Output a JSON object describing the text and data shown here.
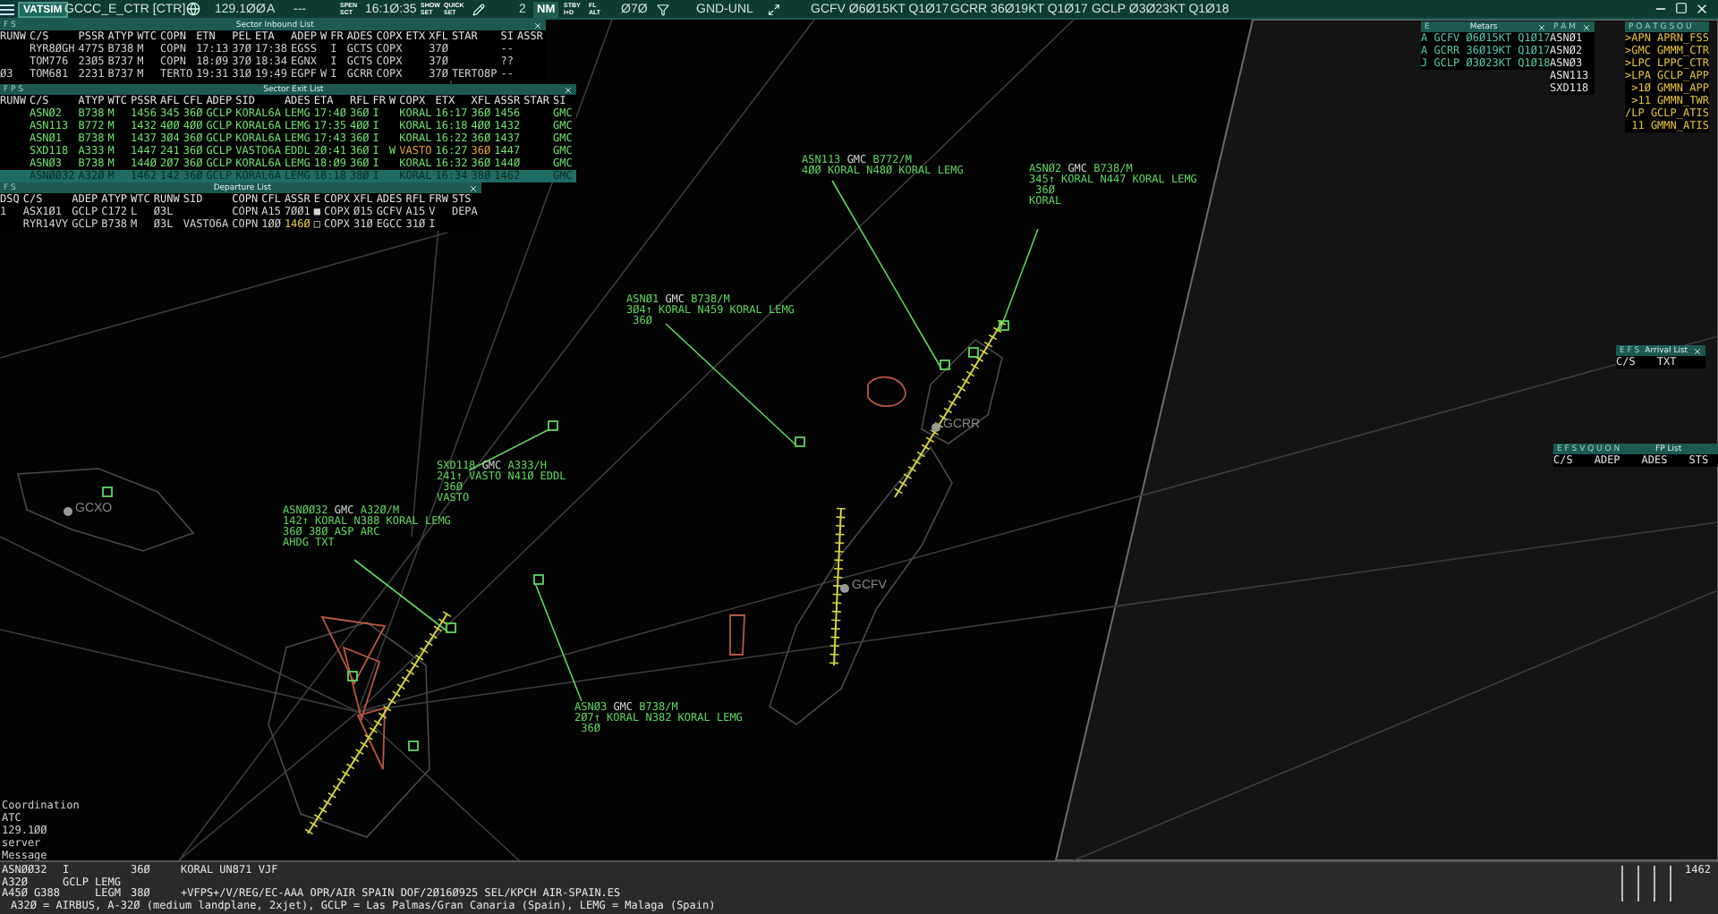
{
  "toolbar": {
    "items": [
      {
        "kind": "menu"
      },
      {
        "kind": "logo",
        "text": "VATSIM"
      },
      {
        "kind": "label",
        "text": "GCCC_E_CTR [CTR]"
      },
      {
        "kind": "globe"
      },
      {
        "kind": "label",
        "text": "129.1ØØ"
      },
      {
        "kind": "label",
        "text": "A"
      },
      {
        "kind": "label",
        "text": "---"
      },
      {
        "kind": "stack",
        "top": "SPEN",
        "bottom": "SCT"
      },
      {
        "kind": "label",
        "text": "16:1Ø:35"
      },
      {
        "kind": "stack",
        "top": "SHOW",
        "bottom": "SET"
      },
      {
        "kind": "stack",
        "top": "QUICK",
        "bottom": "SET"
      },
      {
        "kind": "pencil"
      },
      {
        "kind": "label",
        "text": "2"
      },
      {
        "kind": "button",
        "text": "NM"
      },
      {
        "kind": "stack",
        "top": "STBY",
        "bottom": "I+D"
      },
      {
        "kind": "stack",
        "top": "FL",
        "bottom": "ALT"
      },
      {
        "kind": "label",
        "text": "Ø7Ø"
      },
      {
        "kind": "filter"
      },
      {
        "kind": "label",
        "text": "GND-UNL"
      },
      {
        "kind": "expand"
      },
      {
        "kind": "label",
        "text": "GCFV Ø6Ø15KT Q1Ø17"
      },
      {
        "kind": "label",
        "text": "GCRR 36Ø19KT Q1Ø17"
      },
      {
        "kind": "label",
        "text": "GCLP Ø3Ø23KT Q1Ø18"
      }
    ]
  },
  "lists": [
    {
      "title": "Sector Inbound List",
      "flags": "F S",
      "columns": [
        "RUNW",
        "C/S",
        "PSSR",
        "ATYP",
        "WTC",
        "COPN",
        "ETN",
        "PEL",
        "ETA",
        "ADEP",
        "W",
        "FR",
        "ADES",
        "COPX",
        "ETX",
        "XFL",
        "STAR",
        "SI",
        "ASSR"
      ],
      "rows": [
        {
          "selected": false,
          "cells": [
            null,
            "RYR8ØGH",
            "4775",
            "B738",
            "M",
            "COPN",
            "17:13",
            "37Ø",
            "17:38",
            "EGSS",
            null,
            "I",
            "GCTS",
            "COPX",
            null,
            "37Ø",
            null,
            "--",
            null
          ]
        },
        {
          "selected": false,
          "cells": [
            null,
            "TOM776",
            "23Ø5",
            "B737",
            "M",
            "COPN",
            "18:Ø9",
            "37Ø",
            "18:34",
            "EGNX",
            null,
            "I",
            "GCTS",
            "COPX",
            null,
            "37Ø",
            null,
            "??",
            null
          ]
        },
        {
          "selected": false,
          "cells": [
            "Ø3",
            "TOM681",
            "2231",
            "B737",
            "M",
            "TERTO",
            "19:31",
            "31Ø",
            "19:49",
            "EGPF",
            "W",
            "I",
            "GCRR",
            "COPX",
            null,
            "37Ø",
            "TERTO8P",
            "--",
            null
          ]
        }
      ]
    },
    {
      "title": "Sector Exit List",
      "flags": "F P S",
      "columns": [
        "RUNW",
        "C/S",
        "ATYP",
        "WTC",
        "PSSR",
        "AFL",
        "CFL",
        "ADEP",
        "SID",
        "ADES",
        "ETA",
        "RFL",
        "FR",
        "W",
        "COPX",
        "ETX",
        "XFL",
        "ASSR",
        "STAR",
        "SI"
      ],
      "rows": [
        {
          "selected": false,
          "cells": [
            null,
            "ASNØ2",
            "B738",
            "M",
            "1456",
            "345",
            "36Ø",
            "GCLP",
            "KORAL6A",
            "LEMG",
            "17:4Ø",
            "36Ø",
            "I",
            null,
            "KORAL",
            "16:17",
            "36Ø",
            "1456",
            null,
            "GMC"
          ]
        },
        {
          "selected": false,
          "cells": [
            null,
            "ASN113",
            "B772",
            "M",
            "1432",
            "4ØØ",
            "4ØØ",
            "GCLP",
            "KORAL6A",
            "LEMG",
            "17:35",
            "4ØØ",
            "I",
            null,
            "KORAL",
            "16:18",
            "4ØØ",
            "1432",
            null,
            "GMC"
          ]
        },
        {
          "selected": false,
          "cells": [
            null,
            "ASNØ1",
            "B738",
            "M",
            "1437",
            "3Ø4",
            "36Ø",
            "GCLP",
            "KORAL6A",
            "LEMG",
            "17:43",
            "36Ø",
            "I",
            null,
            "KORAL",
            "16:22",
            "36Ø",
            "1437",
            null,
            "GMC"
          ]
        },
        {
          "selected": false,
          "cells": [
            null,
            "SXD118",
            "A333",
            "M",
            "1447",
            "241",
            "36Ø",
            "GCLP",
            "VASTO6A",
            "EDDL",
            "2Ø:41",
            "36Ø",
            "I",
            "W",
            {
              "text": "VASTO",
              "color": "#e8a33a"
            },
            "16:27",
            {
              "text": "36Ø",
              "color": "#e8a33a"
            },
            "1447",
            null,
            "GMC"
          ]
        },
        {
          "selected": false,
          "cells": [
            null,
            "ASNØ3",
            "B738",
            "M",
            "144Ø",
            "2Ø7",
            "36Ø",
            "GCLP",
            "KORAL6A",
            "LEMG",
            "18:Ø9",
            "36Ø",
            "I",
            null,
            "KORAL",
            "16:32",
            "36Ø",
            "144Ø",
            null,
            "GMC"
          ]
        },
        {
          "selected": true,
          "cells": [
            null,
            "ASNØØ32",
            "A32Ø",
            "M",
            "1462",
            "142",
            "36Ø",
            "GCLP",
            "KORAL6A",
            "LEMG",
            "18:18",
            "38Ø",
            "I",
            null,
            "KORAL",
            "16:34",
            "38Ø",
            "1462",
            null,
            "GMC"
          ]
        }
      ]
    },
    {
      "title": "Departure List",
      "flags": "F S",
      "columns": [
        "DSQ",
        "C/S",
        "ADEP",
        "ATYP",
        "WTC",
        "RUNW",
        "SID",
        "COPN",
        "CFL",
        "ASSR",
        "E",
        "COPX",
        "XFL",
        "ADES",
        "RFL",
        "FRW",
        "STS"
      ],
      "rows": [
        {
          "selected": false,
          "cells": [
            "1",
            "ASX1Ø1",
            "GCLP",
            "C172",
            "L",
            "Ø3L",
            null,
            "COPN",
            "A15",
            "7ØØ1",
            "■",
            "COPX",
            "Ø15",
            "GCFV",
            "A15",
            "V",
            "DEPA"
          ]
        },
        {
          "selected": false,
          "cells": [
            null,
            "RYR14VY",
            "GCLP",
            "B738",
            "M",
            "Ø3L",
            "VASTO6A",
            "COPN",
            "1ØØ",
            {
              "text": "146Ø",
              "color": "#e8d040"
            },
            "□",
            "COPX",
            "31Ø",
            "EGCC",
            "31Ø",
            "I",
            null
          ]
        }
      ]
    }
  ],
  "metar_window": {
    "flags": "E",
    "title": "Metars",
    "lines": [
      "A GCFV Ø6Ø15KT Q1Ø17",
      "A GCRR 36Ø19KT Q1Ø17",
      "J GCLP Ø3Ø23KT Q1Ø18"
    ]
  },
  "callsign_window": {
    "flags": "P A M",
    "items": [
      "ASNØ1",
      "ASNØ2",
      "ASNØ3",
      "ASN113",
      "SXD118"
    ]
  },
  "frequency_window": {
    "flags": "P O A T G S O U",
    "items": [
      ">APN APRN_FSS",
      ">GMC GMMM_CTR",
      ">LPC LPPC_CTR",
      ">LPA GCLP_APP",
      " >1Ø GMMN_APP",
      " >11 GMMN_TWR",
      "/LP GCLP_ATIS",
      " 11 GMMN_ATIS"
    ]
  },
  "small_windows": [
    {
      "flags": "E F S",
      "title": "Arrival List",
      "columns": [
        "C/S",
        "TXT"
      ]
    },
    {
      "flags": "E F S V Q U O N",
      "title": "FP List",
      "columns": [
        "C/S",
        "ADEP",
        "ADES",
        "STS"
      ]
    }
  ],
  "radar": {
    "map_labels": [
      "GCXO",
      "GCRR",
      "GCFV"
    ],
    "tracks": [
      {
        "callsign": "ASN113",
        "sector": "GMC",
        "type": "B772/M",
        "lines": [
          "4ØØ KORAL N48Ø KORAL LEMG"
        ]
      },
      {
        "callsign": "ASNØ2",
        "sector": "GMC",
        "type": "B738/M",
        "lines": [
          "345↑ KORAL N447 KORAL LEMG",
          " 36Ø",
          "KORAL"
        ]
      },
      {
        "callsign": "ASNØ1",
        "sector": "GMC",
        "type": "B738/M",
        "lines": [
          "3Ø4↑ KORAL N459 KORAL LEMG",
          " 36Ø"
        ]
      },
      {
        "callsign": "SXD118",
        "sector": "GMC",
        "type": "A333/H",
        "lines": [
          "241↑ VASTO N41Ø EDDL",
          " 36Ø",
          "VASTO"
        ]
      },
      {
        "callsign": "ASNØØ32",
        "sector": "GMC",
        "type": "A32Ø/M",
        "lines": [
          "142↑ KORAL N388 KORAL LEMG",
          "36Ø 38Ø ASP ARC",
          "AHDG TXT"
        ]
      },
      {
        "callsign": "ASNØ3",
        "sector": "GMC",
        "type": "B738/M",
        "lines": [
          "2Ø7↑ KORAL N382 KORAL LEMG",
          " 36Ø"
        ]
      }
    ]
  },
  "message_panel": [
    "Coordination",
    "ATC",
    "129.1ØØ",
    "server",
    "Message"
  ],
  "flight_strip": {
    "callsign": "ASNØØ32",
    "type": "A32Ø",
    "speed_route": "A45Ø G388",
    "rules": "I",
    "airports": "GCLP LEMG",
    "alternate": "LEGM",
    "cfl": "36Ø",
    "rfl": "38Ø",
    "route": "KORAL UN871 VJF",
    "remarks": "+VFPS+/V/REG/EC-AAA OPR/AIR SPAIN DOF/2Ø16Ø925 SEL/KPCH AIR-SPAIN.ES",
    "squawk": "1462",
    "description": "A32Ø = AIRBUS, A-32Ø (medium landplane, 2xjet), GCLP = Las Palmas/Gran Canaria (Spain), LEMG = Malaga (Spain)"
  }
}
